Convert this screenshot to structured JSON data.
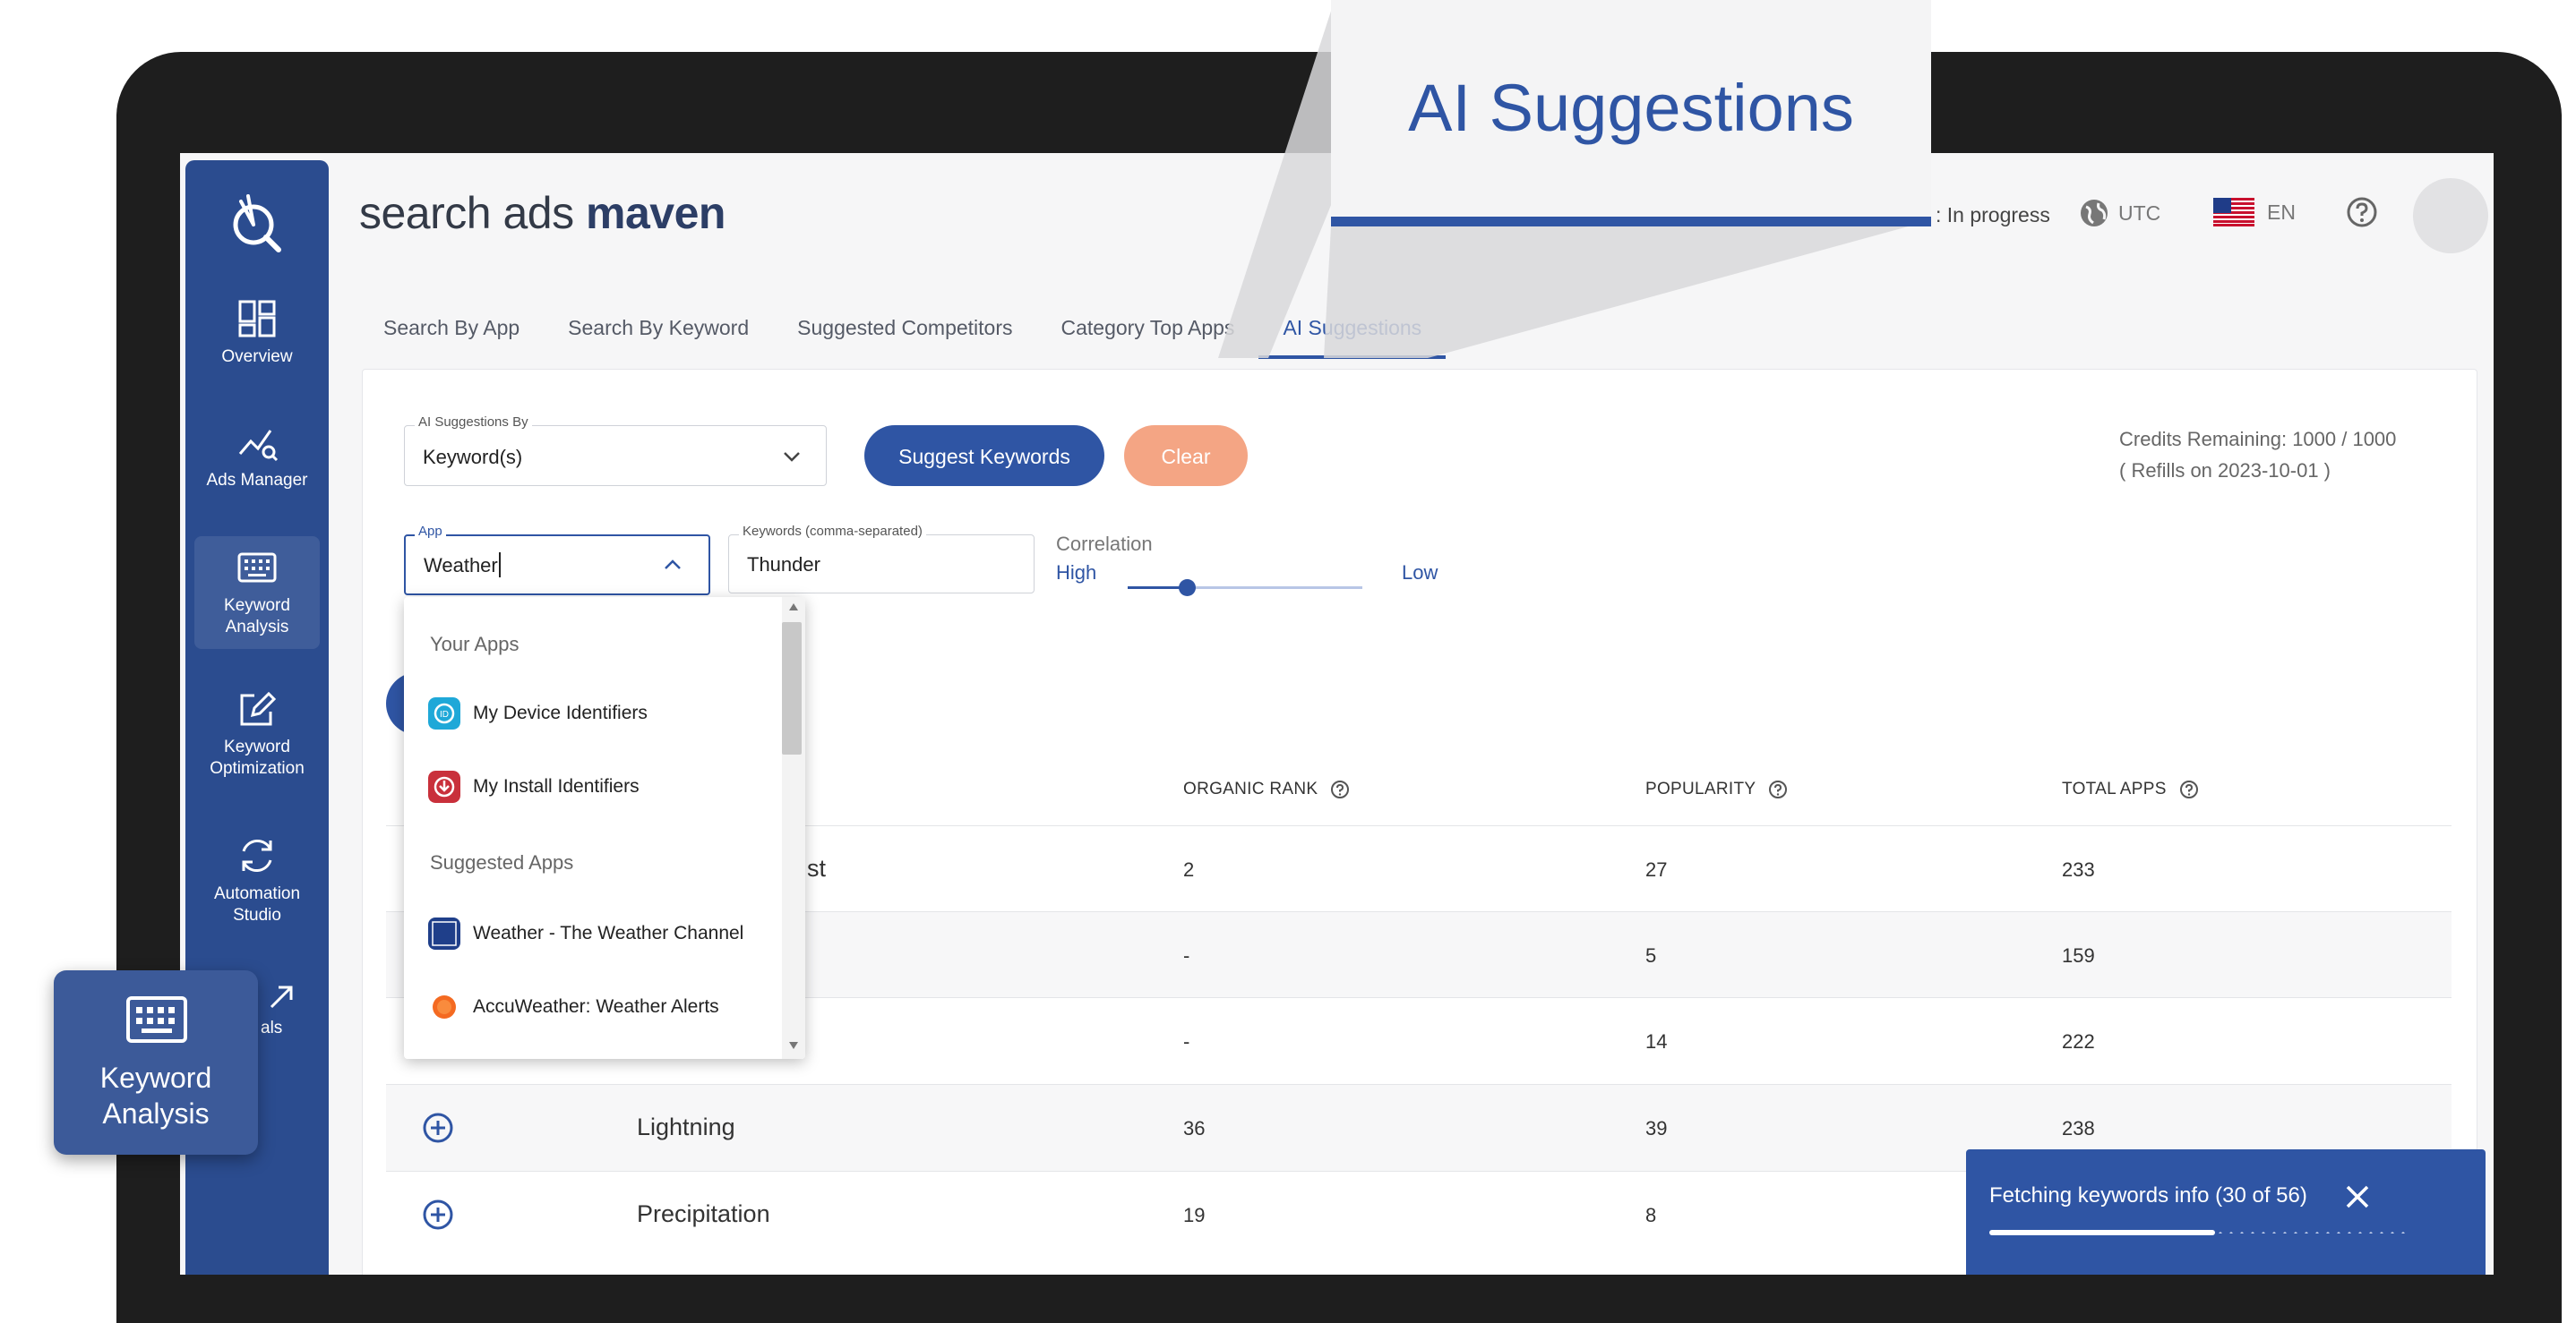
{
  "brand": {
    "prefix": "search ads",
    "suffix": "maven"
  },
  "header": {
    "status": ": In progress",
    "timezone": "UTC",
    "language": "EN"
  },
  "sidebar": {
    "items": [
      {
        "label": "Overview"
      },
      {
        "label": "Ads Manager"
      },
      {
        "label": "Keyword Analysis"
      },
      {
        "label": "Keyword Optimization"
      },
      {
        "label": "Automation Studio"
      },
      {
        "label": "als"
      }
    ]
  },
  "tabs": [
    "Search By App",
    "Search By Keyword",
    "Suggested Competitors",
    "Category Top Apps",
    "AI Suggestions"
  ],
  "form": {
    "suggest_by_label": "AI Suggestions By",
    "suggest_by_value": "Keyword(s)",
    "suggest_button": "Suggest Keywords",
    "clear_button": "Clear",
    "app_label": "App",
    "app_value": "Weather",
    "keywords_label": "Keywords (comma-separated)",
    "keywords_value": "Thunder",
    "correlation_label": "Correlation",
    "correlation_high": "High",
    "correlation_low": "Low",
    "correlation_level": 0.25
  },
  "credits": {
    "line1": "Credits Remaining: 1000 / 1000",
    "line2": "( Refills on 2023-10-01 )"
  },
  "dropdown": {
    "your_apps_header": "Your Apps",
    "your_apps": [
      "My Device Identifiers",
      "My Install Identifiers"
    ],
    "suggested_header": "Suggested Apps",
    "suggested": [
      "Weather - The Weather Channel",
      "AccuWeather: Weather Alerts"
    ]
  },
  "table": {
    "headers": {
      "organic_rank": "ORGANIC RANK",
      "popularity": "POPULARITY",
      "total_apps": "TOTAL APPS"
    },
    "rows": [
      {
        "keyword": "st",
        "rank": "2",
        "popularity": "27",
        "total": "233"
      },
      {
        "keyword": "",
        "rank": "-",
        "popularity": "5",
        "total": "159"
      },
      {
        "keyword": "",
        "rank": "-",
        "popularity": "14",
        "total": "222"
      },
      {
        "keyword": "Lightning",
        "rank": "36",
        "popularity": "39",
        "total": "238"
      },
      {
        "keyword": "Precipitation",
        "rank": "19",
        "popularity": "8",
        "total": ""
      }
    ]
  },
  "toast": {
    "text": "Fetching keywords info (30 of 56)",
    "progress": 0.536
  },
  "callout": {
    "title": "AI Suggestions"
  },
  "badge": {
    "title": "Keyword Analysis"
  },
  "colors": {
    "primary": "#2f55a4",
    "sidebar": "#2b4c8f",
    "clear": "#f4a584"
  }
}
